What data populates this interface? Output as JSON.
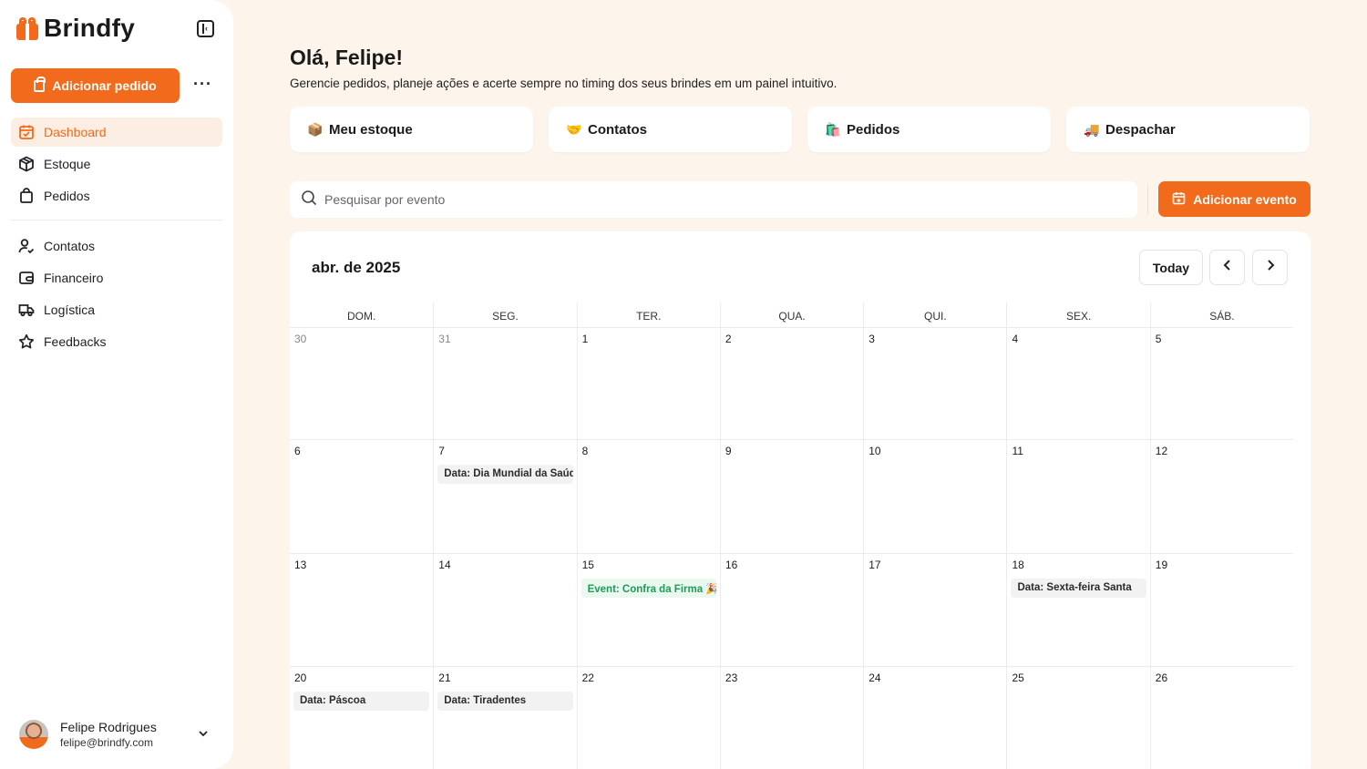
{
  "brand": {
    "name": "Brindfy"
  },
  "sidebar": {
    "add_order_label": "Adicionar pedido",
    "more_label": "···",
    "nav_primary": [
      {
        "label": "Dashboard",
        "icon": "calendar-icon",
        "active": true
      },
      {
        "label": "Estoque",
        "icon": "box-icon",
        "active": false
      },
      {
        "label": "Pedidos",
        "icon": "shopping-bag-icon",
        "active": false
      }
    ],
    "nav_secondary": [
      {
        "label": "Contatos",
        "icon": "user-check-icon"
      },
      {
        "label": "Financeiro",
        "icon": "wallet-icon"
      },
      {
        "label": "Logística",
        "icon": "truck-icon"
      },
      {
        "label": "Feedbacks",
        "icon": "star-icon"
      }
    ],
    "user": {
      "name": "Felipe Rodrigues",
      "email": "felipe@brindfy.com"
    }
  },
  "header": {
    "greeting": "Olá, Felipe!",
    "subtitle": "Gerencie pedidos, planeje ações e acerte sempre no timing dos seus brindes em um painel intuitivo."
  },
  "quick_actions": [
    {
      "label": "Meu estoque",
      "emoji": "📦"
    },
    {
      "label": "Contatos",
      "emoji": "🤝"
    },
    {
      "label": "Pedidos",
      "emoji": "🛍️"
    },
    {
      "label": "Despachar",
      "emoji": "🚚"
    }
  ],
  "search": {
    "placeholder": "Pesquisar por evento",
    "value": ""
  },
  "add_event_label": "Adicionar evento",
  "calendar": {
    "month_label": "abr. de 2025",
    "today_label": "Today",
    "weekdays": [
      "DOM.",
      "SEG.",
      "TER.",
      "QUA.",
      "QUI.",
      "SEX.",
      "SÁB."
    ],
    "weeks": [
      [
        {
          "day": "30",
          "muted": true
        },
        {
          "day": "31",
          "muted": true
        },
        {
          "day": "1"
        },
        {
          "day": "2"
        },
        {
          "day": "3"
        },
        {
          "day": "4"
        },
        {
          "day": "5"
        }
      ],
      [
        {
          "day": "6"
        },
        {
          "day": "7",
          "event": "Data: Dia Mundial da Saúde"
        },
        {
          "day": "8"
        },
        {
          "day": "9"
        },
        {
          "day": "10"
        },
        {
          "day": "11"
        },
        {
          "day": "12"
        }
      ],
      [
        {
          "day": "13"
        },
        {
          "day": "14"
        },
        {
          "day": "15",
          "event": "Event: Confra da Firma 🎉",
          "event_style": "green"
        },
        {
          "day": "16"
        },
        {
          "day": "17"
        },
        {
          "day": "18",
          "event": "Data: Sexta-feira Santa"
        },
        {
          "day": "19"
        }
      ],
      [
        {
          "day": "20",
          "event": "Data: Páscoa"
        },
        {
          "day": "21",
          "event": "Data: Tiradentes"
        },
        {
          "day": "22"
        },
        {
          "day": "23"
        },
        {
          "day": "24"
        },
        {
          "day": "25"
        },
        {
          "day": "26"
        }
      ]
    ]
  },
  "colors": {
    "accent": "#f26a1b",
    "background": "#fdf4ec",
    "event_green": "#1e9b5a"
  }
}
